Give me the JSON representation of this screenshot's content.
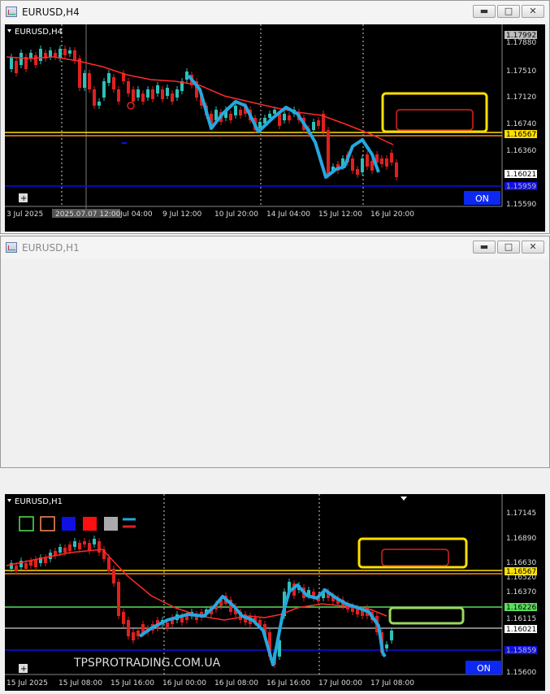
{
  "windows": {
    "top": {
      "title": "EURUSD,H4",
      "chart_label": "EURUSD,H4",
      "price_labels": [
        "1.17992",
        "1.17880",
        "1.17510",
        "1.17120",
        "1.16740",
        "1.16567",
        "1.16360",
        "1.16021",
        "1.15959",
        "1.15590"
      ],
      "time_labels": [
        "3 Jul 2025",
        "2025.07.07 12:00",
        "Jul 04:00",
        "9 Jul 12:00",
        "10 Jul 20:00",
        "14 Jul 04:00",
        "15 Jul 12:00",
        "16 Jul 20:00"
      ],
      "on_button": "ON"
    },
    "bottom": {
      "title": "EURUSD,H1",
      "chart_label": "EURUSD,H1",
      "price_labels": [
        "1.17145",
        "1.16890",
        "1.16630",
        "1.16567",
        "1.16520",
        "1.16370",
        "1.16226",
        "1.16115",
        "1.16021",
        "1.15859",
        "1.15600"
      ],
      "time_labels": [
        "15 Jul 2025",
        "15 Jul 08:00",
        "15 Jul 16:00",
        "16 Jul 00:00",
        "16 Jul 08:00",
        "16 Jul 16:00",
        "17 Jul 00:00",
        "17 Jul 08:00"
      ],
      "watermark": "TPSPROTRADING.COM.UA",
      "on_button": "ON"
    }
  },
  "window_buttons": {
    "minimize": "▬",
    "maximize": "□",
    "close": "✕"
  },
  "colors": {
    "background": "#000000",
    "bull": "#2ec0b8",
    "bear": "#e02020",
    "ma": "#ff2a2a",
    "wave": "#23a8e0",
    "yellow": "#ffe000",
    "orange": "#ff8c00",
    "green": "#59e05a",
    "blue": "#1010e0",
    "on_bg": "#0d28f0"
  }
}
